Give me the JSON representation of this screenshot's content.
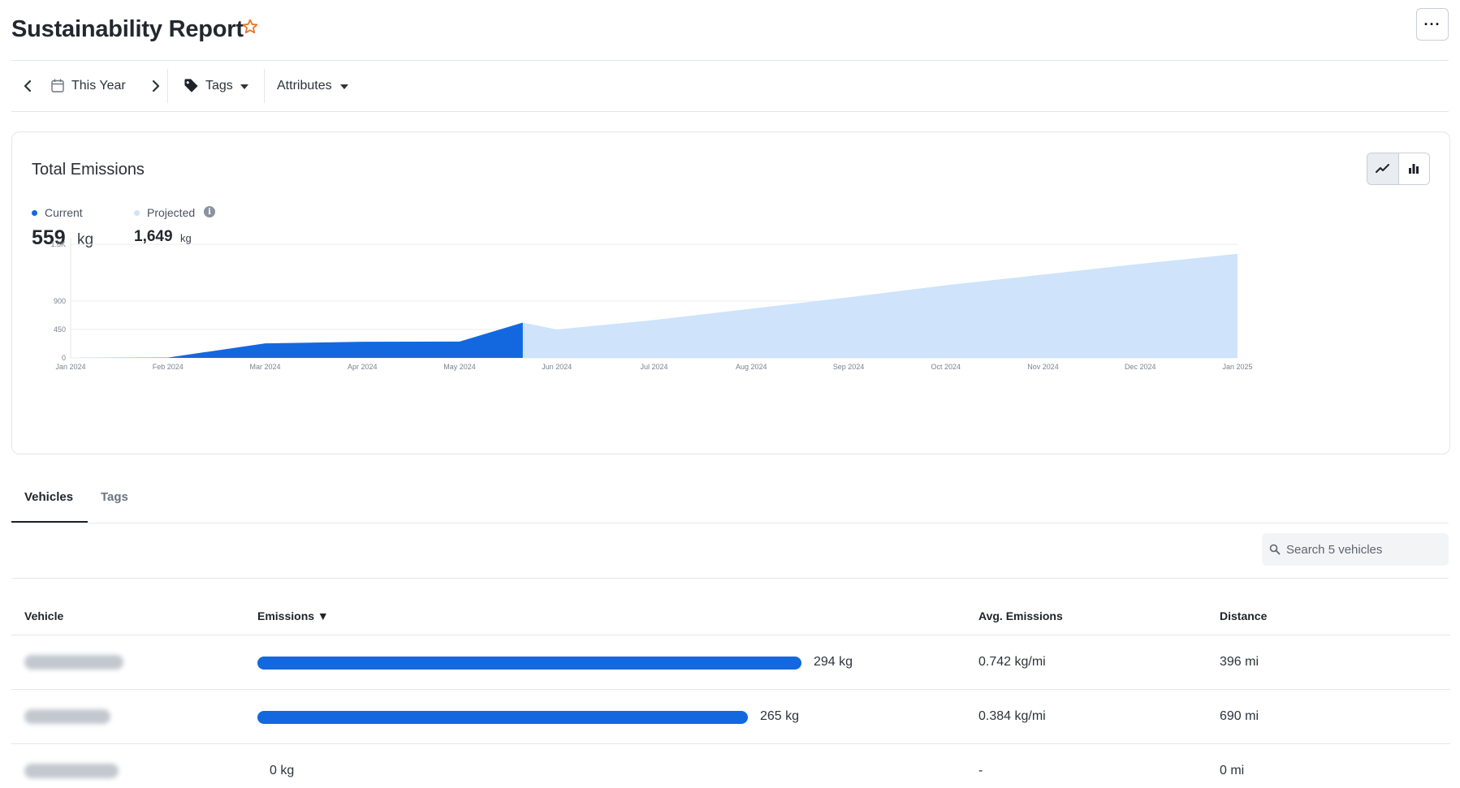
{
  "header": {
    "title": "Sustainability Report",
    "more_label": "···"
  },
  "filters": {
    "date_range": "This Year",
    "tags_label": "Tags",
    "attributes_label": "Attributes"
  },
  "emissions_card": {
    "title": "Total Emissions",
    "current": {
      "label": "Current",
      "value": "559",
      "unit": "kg",
      "color": "#1368e0"
    },
    "projected": {
      "label": "Projected",
      "value": "1,649",
      "unit": "kg",
      "color": "#cfe3fb"
    },
    "info_icon": "i"
  },
  "chart_data": {
    "type": "area",
    "x": [
      "Jan 2024",
      "Feb 2024",
      "Mar 2024",
      "Apr 2024",
      "May 2024",
      "Jun 2024",
      "Jul 2024",
      "Aug 2024",
      "Sep 2024",
      "Oct 2024",
      "Nov 2024",
      "Dec 2024",
      "Jan 2025"
    ],
    "series": [
      {
        "name": "Current",
        "color": "#1368e0",
        "points": [
          [
            "Jan 2024",
            0
          ],
          [
            "Feb 2024",
            5
          ],
          [
            "Mar 2024",
            230
          ],
          [
            "Apr 2024",
            255
          ],
          [
            "May 2024",
            259
          ],
          [
            "May 24 2024",
            559
          ]
        ]
      },
      {
        "name": "Projected",
        "color": "#cfe3fb",
        "points": [
          [
            "May 24 2024",
            559
          ],
          [
            "Jun 2024",
            450
          ],
          [
            "Jul 2024",
            600
          ],
          [
            "Aug 2024",
            780
          ],
          [
            "Sep 2024",
            960
          ],
          [
            "Oct 2024",
            1150
          ],
          [
            "Nov 2024",
            1320
          ],
          [
            "Dec 2024",
            1490
          ],
          [
            "Jan 2025",
            1649
          ]
        ]
      }
    ],
    "y_ticks": [
      "0",
      "450",
      "900",
      "1.8K"
    ],
    "ylim": [
      0,
      1800
    ],
    "grid": true
  },
  "tabs": [
    {
      "label": "Vehicles",
      "active": true
    },
    {
      "label": "Tags",
      "active": false
    }
  ],
  "search": {
    "placeholder": "Search 5 vehicles"
  },
  "table": {
    "columns": [
      "Vehicle",
      "Emissions ▼",
      "Avg. Emissions",
      "Distance"
    ],
    "rows": [
      {
        "emissions": "294 kg",
        "emissions_value": 294,
        "avg": "0.742 kg/mi",
        "distance": "396 mi"
      },
      {
        "emissions": "265 kg",
        "emissions_value": 265,
        "avg": "0.384 kg/mi",
        "distance": "690 mi"
      },
      {
        "emissions": "0 kg",
        "emissions_value": 0,
        "avg": "-",
        "distance": "0 mi"
      }
    ]
  }
}
